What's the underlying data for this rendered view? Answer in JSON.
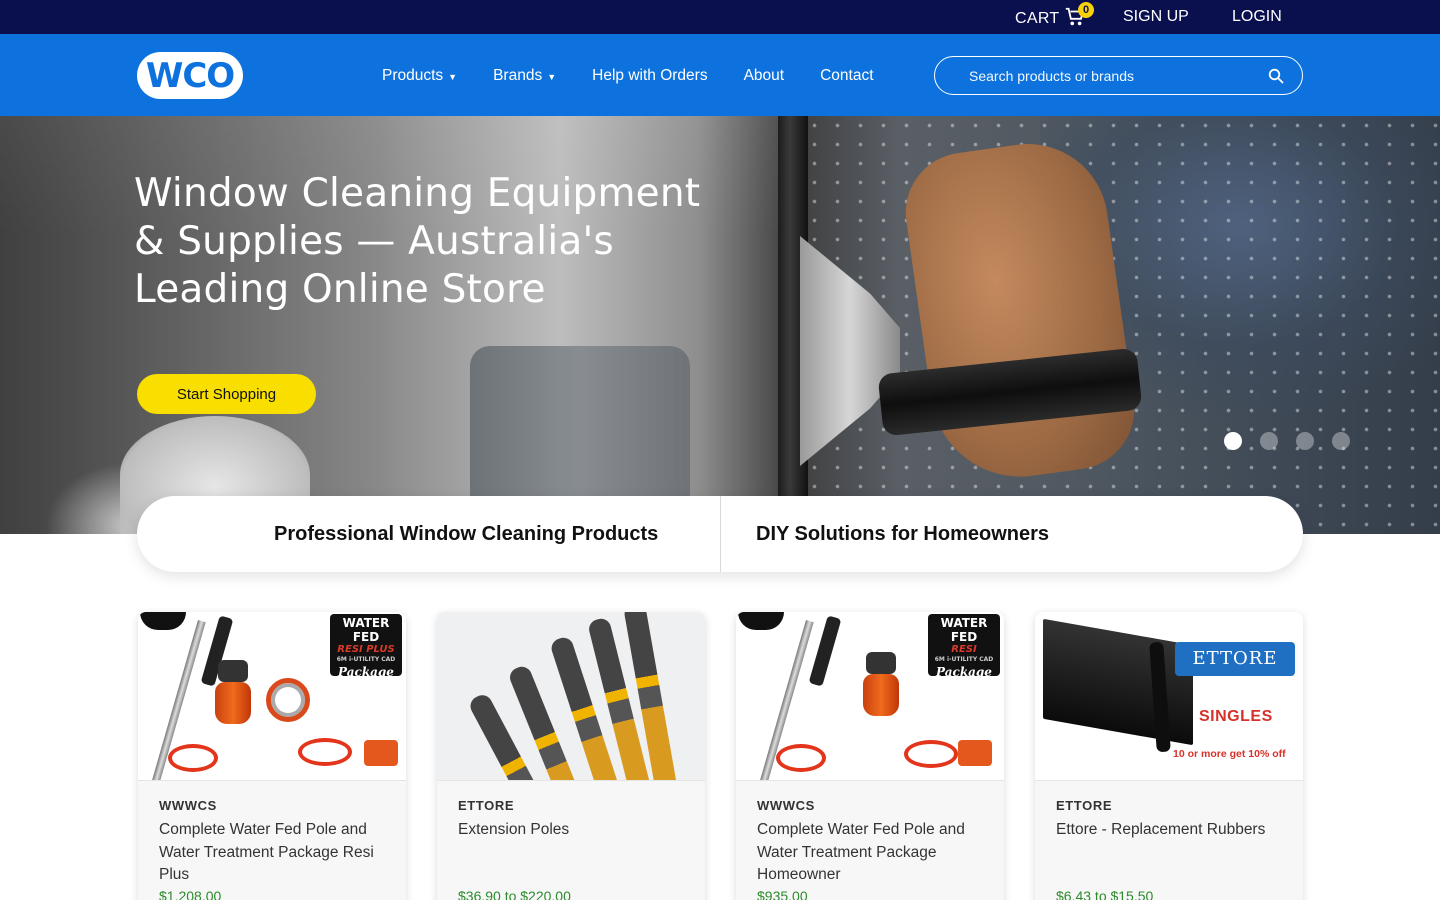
{
  "topbar": {
    "cart_label": "CART",
    "cart_count": "0",
    "signup_label": "SIGN UP",
    "login_label": "LOGIN"
  },
  "header": {
    "logo_text": "WCO",
    "nav": [
      {
        "label": "Products",
        "has_dropdown": true
      },
      {
        "label": "Brands",
        "has_dropdown": true
      },
      {
        "label": "Help with Orders",
        "has_dropdown": false
      },
      {
        "label": "About",
        "has_dropdown": false
      },
      {
        "label": "Contact",
        "has_dropdown": false
      }
    ],
    "search_placeholder": "Search products or brands",
    "search_icon": "search-icon"
  },
  "hero": {
    "title": "Window Cleaning Equipment & Supplies — Australia's Leading Online Store",
    "cta_label": "Start Shopping",
    "slides_total": 4,
    "active_slide": 1
  },
  "category_switch": {
    "option_1": "Professional Window Cleaning Products",
    "option_2": "DIY Solutions for Homeowners"
  },
  "products": [
    {
      "brand": "WWWCS",
      "name": "Complete Water Fed Pole and Water Treatment Package Resi Plus",
      "price": "$1,208.00",
      "badge_lines": [
        "WATER FED",
        "RESI PLUS",
        "6M i-UTILITY CAD",
        "Package"
      ]
    },
    {
      "brand": "ETTORE",
      "name": "Extension Poles",
      "price": "$36.90 to $220.00"
    },
    {
      "brand": "WWWCS",
      "name": "Complete Water Fed Pole and Water Treatment Package Homeowner",
      "price": "$935.00",
      "badge_lines": [
        "WATER FED",
        "RESI",
        "6M i-UTILITY CAD",
        "Package"
      ]
    },
    {
      "brand": "ETTORE",
      "name": "Ettore - Replacement Rubbers",
      "price": "$6.43 to $15.50",
      "image_text": {
        "logo": "ETTORE",
        "headline": "SINGLES",
        "deal": "10 or more get 10% off"
      }
    }
  ],
  "colors": {
    "topbar_bg": "#0a0f4d",
    "header_bg": "#0d72dd",
    "cta_bg": "#f8df00",
    "price": "#2c8b2c"
  }
}
